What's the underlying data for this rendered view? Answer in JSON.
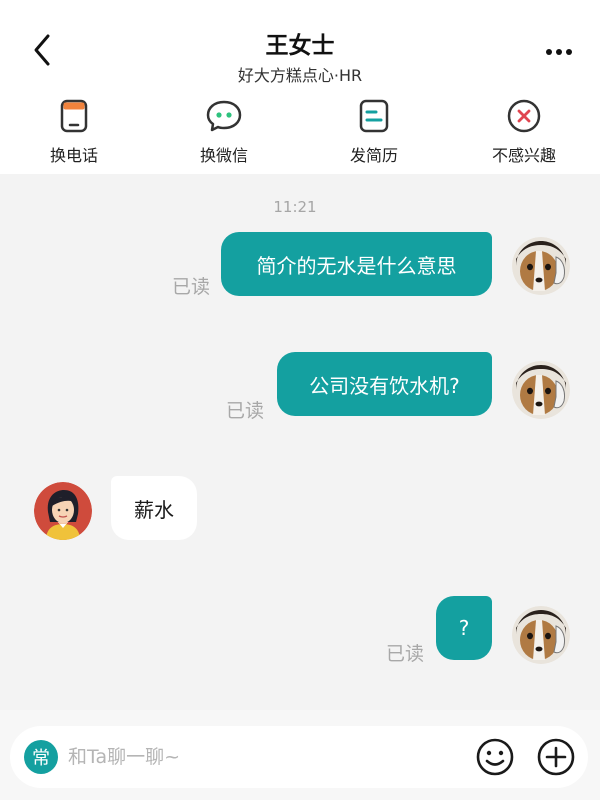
{
  "header": {
    "title": "王女士",
    "subtitle": "好大方糕点心·HR"
  },
  "actions": [
    {
      "label": "换电话",
      "icon": "phone-icon"
    },
    {
      "label": "换微信",
      "icon": "wechat-icon"
    },
    {
      "label": "发简历",
      "icon": "resume-icon"
    },
    {
      "label": "不感兴趣",
      "icon": "not-interested-icon"
    }
  ],
  "chat": {
    "time": "11:21",
    "messages": [
      {
        "from": "me",
        "text": "简介的无水是什么意思",
        "status": "已读"
      },
      {
        "from": "me",
        "text": "公司没有饮水机?",
        "status": "已读"
      },
      {
        "from": "them",
        "text": "薪水"
      },
      {
        "from": "me",
        "text": "?",
        "status": "已读"
      }
    ]
  },
  "input": {
    "common_phrases_label": "常",
    "placeholder": "和Ta聊一聊~"
  },
  "colors": {
    "accent": "#14a0a0",
    "chat_background": "#f3f3f3",
    "read_status": "#a8a8a8"
  }
}
